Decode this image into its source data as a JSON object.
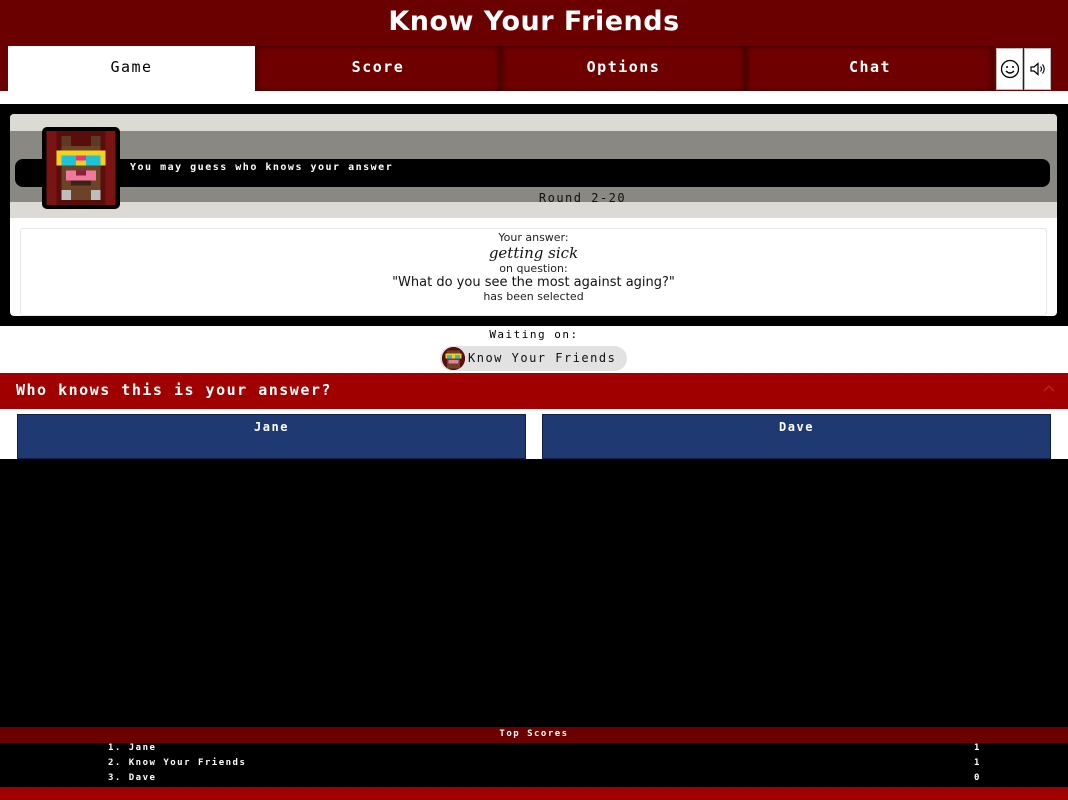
{
  "app": {
    "title": "Know Your Friends"
  },
  "nav": {
    "tabs": [
      {
        "label": "Game",
        "active": true
      },
      {
        "label": "Score",
        "active": false
      },
      {
        "label": "Options",
        "active": false
      },
      {
        "label": "Chat",
        "active": false
      }
    ],
    "icons": [
      "smiley-icon",
      "speaker-icon"
    ]
  },
  "game": {
    "message": "You may guess who knows your answer",
    "round": "Round 2-20",
    "answer": {
      "your_answer_label": "Your answer:",
      "answer_text": "getting sick",
      "on_question_label": "on question:",
      "question_text": "\"What do you see the most against aging?\"",
      "selected_label": "has been selected"
    }
  },
  "waiting": {
    "label": "Waiting on:",
    "player": "Know Your Friends"
  },
  "who_knows": {
    "title": "Who knows this is your answer?",
    "players": [
      "Jane",
      "Dave"
    ]
  },
  "scores": {
    "title": "Top Scores",
    "rows": [
      {
        "name": "1. Jane",
        "score": "1"
      },
      {
        "name": "2. Know Your Friends",
        "score": "1"
      },
      {
        "name": "3. Dave",
        "score": "0"
      }
    ]
  },
  "colors": {
    "header": "#6b0000",
    "accent": "#a10000",
    "card_blue": "#1f3a73"
  }
}
